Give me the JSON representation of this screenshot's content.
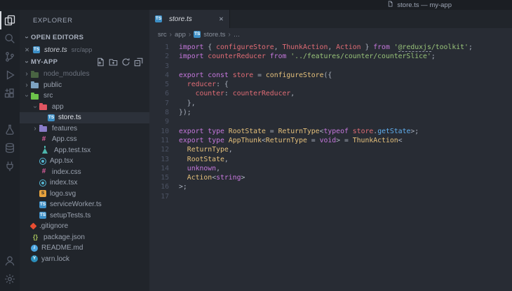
{
  "titlebar": {
    "title": "store.ts — my-app"
  },
  "activitybar": {
    "top": [
      {
        "name": "explorer",
        "active": true
      },
      {
        "name": "search",
        "active": false
      },
      {
        "name": "source-control",
        "active": false
      },
      {
        "name": "run-debug",
        "active": false
      },
      {
        "name": "extensions",
        "active": false
      }
    ],
    "middle": [
      {
        "name": "test-flask",
        "active": false
      },
      {
        "name": "database",
        "active": false
      },
      {
        "name": "plug",
        "active": false
      }
    ],
    "bottom": [
      {
        "name": "account",
        "active": false
      },
      {
        "name": "settings-gear",
        "active": false
      }
    ]
  },
  "sidebar": {
    "title": "EXPLORER",
    "open_editors": {
      "header": "OPEN EDITORS",
      "item": {
        "close": "✕",
        "label": "store.ts",
        "detail": "src/app"
      }
    },
    "project": {
      "header": "MY-APP",
      "actions": [
        "new-file",
        "new-folder",
        "refresh",
        "collapse-all"
      ]
    },
    "tree": [
      {
        "label": "node_modules",
        "icon": "folder",
        "color": "#6a9955",
        "indent": 0,
        "expand": "closed",
        "dim": true
      },
      {
        "label": "public",
        "icon": "folder",
        "color": "#7da2c1",
        "indent": 0,
        "expand": "closed"
      },
      {
        "label": "src",
        "icon": "folder",
        "color": "#6cc24a",
        "indent": 0,
        "expand": "open"
      },
      {
        "label": "app",
        "icon": "folder",
        "color": "#e05561",
        "indent": 1,
        "expand": "open"
      },
      {
        "label": "store.ts",
        "icon": "ts",
        "color": "#3d8fc6",
        "indent": 2,
        "selected": true
      },
      {
        "label": "features",
        "icon": "folder",
        "color": "#8a7cc8",
        "indent": 1,
        "expand": "closed"
      },
      {
        "label": "App.css",
        "icon": "css",
        "color": "#e05fa0",
        "indent": 1
      },
      {
        "label": "App.test.tsx",
        "icon": "flask",
        "color": "#4db6ac",
        "indent": 1
      },
      {
        "label": "App.tsx",
        "icon": "react",
        "color": "#55b7d4",
        "indent": 1
      },
      {
        "label": "index.css",
        "icon": "css",
        "color": "#e05fa0",
        "indent": 1
      },
      {
        "label": "index.tsx",
        "icon": "react",
        "color": "#55b7d4",
        "indent": 1
      },
      {
        "label": "logo.svg",
        "icon": "svg",
        "color": "#e8a33d",
        "indent": 1
      },
      {
        "label": "serviceWorker.ts",
        "icon": "ts",
        "color": "#3d8fc6",
        "indent": 1
      },
      {
        "label": "setupTests.ts",
        "icon": "ts",
        "color": "#3d8fc6",
        "indent": 1
      },
      {
        "label": ".gitignore",
        "icon": "git",
        "color": "#e84d31",
        "indent": 0
      },
      {
        "label": "package.json",
        "icon": "json",
        "color": "#a5c25c",
        "indent": 0
      },
      {
        "label": "README.md",
        "icon": "readme",
        "color": "#4aa3df",
        "indent": 0
      },
      {
        "label": "yarn.lock",
        "icon": "yarn",
        "color": "#2c8ebb",
        "indent": 0
      }
    ]
  },
  "editor": {
    "tab": {
      "label": "store.ts",
      "close": "✕"
    },
    "breadcrumbs": {
      "items": [
        {
          "label": "src"
        },
        {
          "label": "app"
        },
        {
          "label": "store.ts",
          "icon": "ts"
        },
        {
          "label": "…"
        }
      ]
    },
    "code": {
      "line_start": 1,
      "token_colors": {
        "kw": "#c678dd",
        "var": "#e06c75",
        "typ": "#e5c07b",
        "fn": "#e5c07b",
        "meth": "#61afef",
        "str": "#98c379",
        "stru": "#98c379",
        "pl": "#abb2bf"
      },
      "lines": [
        [
          [
            "kw",
            "import"
          ],
          [
            "pl",
            " { "
          ],
          [
            "var",
            "configureStore"
          ],
          [
            "pl",
            ", "
          ],
          [
            "var",
            "ThunkAction"
          ],
          [
            "pl",
            ", "
          ],
          [
            "var",
            "Action"
          ],
          [
            "pl",
            " } "
          ],
          [
            "kw",
            "from"
          ],
          [
            "pl",
            " "
          ],
          [
            "str",
            "'"
          ],
          [
            "stru",
            "@reduxjs"
          ],
          [
            "str",
            "/toolkit'"
          ],
          [
            "pl",
            ";"
          ]
        ],
        [
          [
            "kw",
            "import"
          ],
          [
            "pl",
            " "
          ],
          [
            "var",
            "counterReducer"
          ],
          [
            "pl",
            " "
          ],
          [
            "kw",
            "from"
          ],
          [
            "pl",
            " "
          ],
          [
            "str",
            "'../features/counter/counterSlice'"
          ],
          [
            "pl",
            ";"
          ]
        ],
        [],
        [
          [
            "kw",
            "export"
          ],
          [
            "pl",
            " "
          ],
          [
            "kw",
            "const"
          ],
          [
            "pl",
            " "
          ],
          [
            "var",
            "store"
          ],
          [
            "pl",
            " = "
          ],
          [
            "fn",
            "configureStore"
          ],
          [
            "pl",
            "({"
          ]
        ],
        [
          [
            "pl",
            "  "
          ],
          [
            "var",
            "reducer"
          ],
          [
            "pl",
            ": {"
          ]
        ],
        [
          [
            "pl",
            "    "
          ],
          [
            "var",
            "counter"
          ],
          [
            "pl",
            ": "
          ],
          [
            "var",
            "counterReducer"
          ],
          [
            "pl",
            ","
          ]
        ],
        [
          [
            "pl",
            "  },"
          ]
        ],
        [
          [
            "pl",
            "});"
          ]
        ],
        [],
        [
          [
            "kw",
            "export"
          ],
          [
            "pl",
            " "
          ],
          [
            "kw",
            "type"
          ],
          [
            "pl",
            " "
          ],
          [
            "typ",
            "RootState"
          ],
          [
            "pl",
            " = "
          ],
          [
            "typ",
            "ReturnType"
          ],
          [
            "pl",
            "<"
          ],
          [
            "kw",
            "typeof"
          ],
          [
            "pl",
            " "
          ],
          [
            "var",
            "store"
          ],
          [
            "pl",
            "."
          ],
          [
            "meth",
            "getState"
          ],
          [
            "pl",
            ">;"
          ]
        ],
        [
          [
            "kw",
            "export"
          ],
          [
            "pl",
            " "
          ],
          [
            "kw",
            "type"
          ],
          [
            "pl",
            " "
          ],
          [
            "typ",
            "AppThunk"
          ],
          [
            "pl",
            "<"
          ],
          [
            "typ",
            "ReturnType"
          ],
          [
            "pl",
            " = "
          ],
          [
            "kw",
            "void"
          ],
          [
            "pl",
            "> = "
          ],
          [
            "typ",
            "ThunkAction"
          ],
          [
            "pl",
            "<"
          ]
        ],
        [
          [
            "pl",
            "  "
          ],
          [
            "typ",
            "ReturnType"
          ],
          [
            "pl",
            ","
          ]
        ],
        [
          [
            "pl",
            "  "
          ],
          [
            "typ",
            "RootState"
          ],
          [
            "pl",
            ","
          ]
        ],
        [
          [
            "pl",
            "  "
          ],
          [
            "kw",
            "unknown"
          ],
          [
            "pl",
            ","
          ]
        ],
        [
          [
            "pl",
            "  "
          ],
          [
            "typ",
            "Action"
          ],
          [
            "pl",
            "<"
          ],
          [
            "kw",
            "string"
          ],
          [
            "pl",
            ">"
          ]
        ],
        [
          [
            "pl",
            ">;"
          ]
        ],
        []
      ]
    }
  }
}
